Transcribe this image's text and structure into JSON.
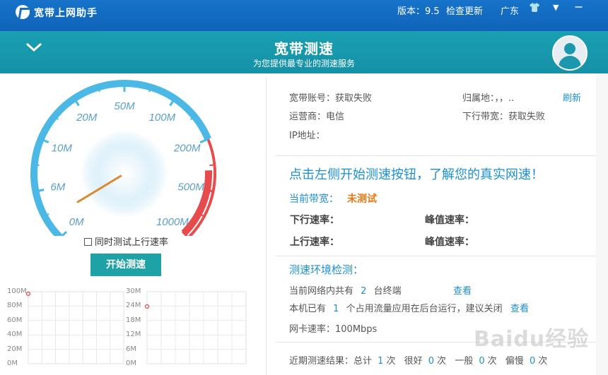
{
  "titlebar": {
    "app_title": "宽带上网助手",
    "version": "版本：9.5",
    "check_update": "检查更新",
    "region": "广东",
    "skin_icon": "shirt-icon",
    "menu_icon": "menu-dropdown-icon",
    "minimize": "−"
  },
  "banner": {
    "collapse_icon": "chevron-down-icon",
    "title": "宽带测速",
    "subtitle": "为您提供最专业的测速服务",
    "avatar_icon": "user-avatar-icon"
  },
  "gauge": {
    "ticks": [
      "0M",
      "6M",
      "10M",
      "20M",
      "50M",
      "100M",
      "200M",
      "500M",
      "1000M"
    ],
    "needle_value": "0M",
    "colors": {
      "arc": "#4bb8e6",
      "danger": "#e84b4b",
      "needle": "#e08a2e"
    }
  },
  "options": {
    "sync_upload_label": "同时测试上行速率",
    "sync_upload_checked": false,
    "start_button": "开始测速"
  },
  "graphs": {
    "download_axis": [
      "100M",
      "80M",
      "60M",
      "40M",
      "20M",
      "0M"
    ],
    "upload_axis": [
      "30M",
      "24M",
      "18M",
      "12M",
      "6M",
      "0M"
    ]
  },
  "account": {
    "account_label": "宽带账号：",
    "account_value": "获取失败",
    "location_label": "归属地：",
    "location_value": "，，..",
    "refresh": "刷新",
    "isp_label": "运营商：",
    "isp_value": "电信",
    "down_bw_label": "下行带宽：",
    "down_bw_value": "获取失败",
    "ip_label": "IP地址："
  },
  "test": {
    "headline": "点击左侧开始测速按钮，了解您的真实网速！",
    "current_bw_label": "当前带宽：",
    "current_bw_value": "未测试",
    "down_rate": "下行速率：",
    "peak_rate_1": "峰值速率：",
    "up_rate": "上行速率：",
    "peak_rate_2": "峰值速率："
  },
  "env": {
    "title": "测速环境检测：",
    "devices_prefix": "当前网络内共有",
    "devices_count": "2",
    "devices_suffix": "台终端",
    "view_1": "查看",
    "apps_prefix": "本机已有",
    "apps_count": "1",
    "apps_suffix": "个占用流量应用在后台运行，建议关闭",
    "view_2": "查看",
    "nic_speed": "网卡速率：100Mbps"
  },
  "history": {
    "label": "近期测速结果：总计",
    "total": "1",
    "times_1": "次",
    "good": "很好",
    "good_count": "0",
    "times_2": "次",
    "normal": "一般",
    "normal_count": "0",
    "times_3": "次",
    "slow": "偏慢",
    "slow_count": "0",
    "times_4": "次"
  },
  "watermark": "Baidu经验"
}
